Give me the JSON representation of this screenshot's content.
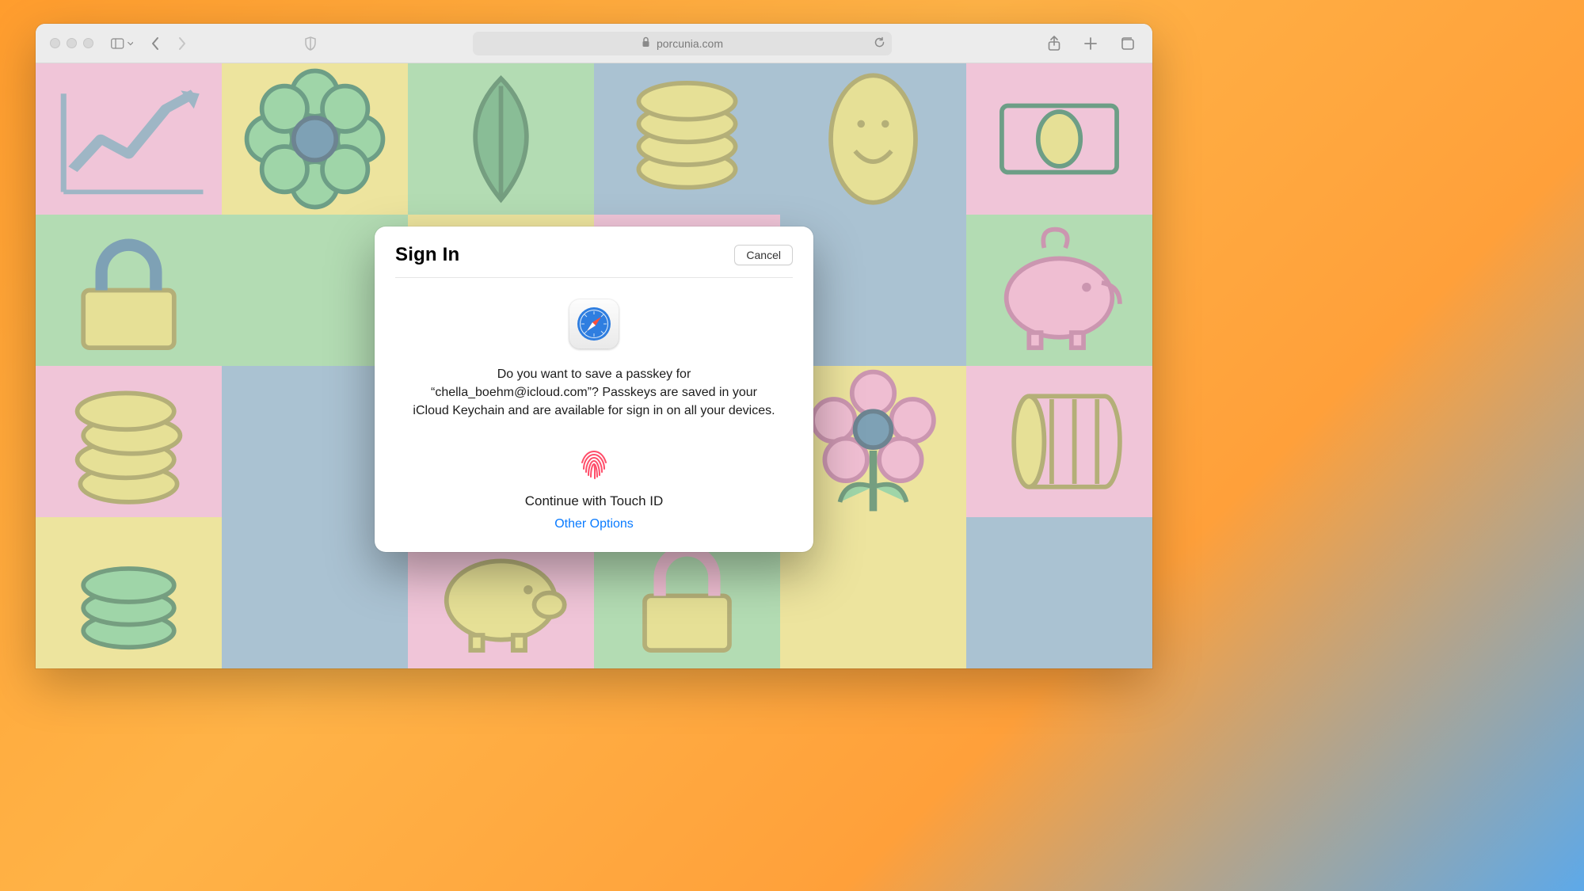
{
  "toolbar": {
    "address_text": "porcunia.com"
  },
  "dialog": {
    "title": "Sign In",
    "cancel_label": "Cancel",
    "message": "Do you want to save a passkey for “chella_boehm@icloud.com”? Passkeys are saved in your iCloud Keychain and are available for sign in on all your devices.",
    "continue_label": "Continue with Touch ID",
    "other_options_label": "Other Options"
  },
  "colors": {
    "accent_link": "#0a7bff",
    "touchid": "#ff4e6a"
  }
}
